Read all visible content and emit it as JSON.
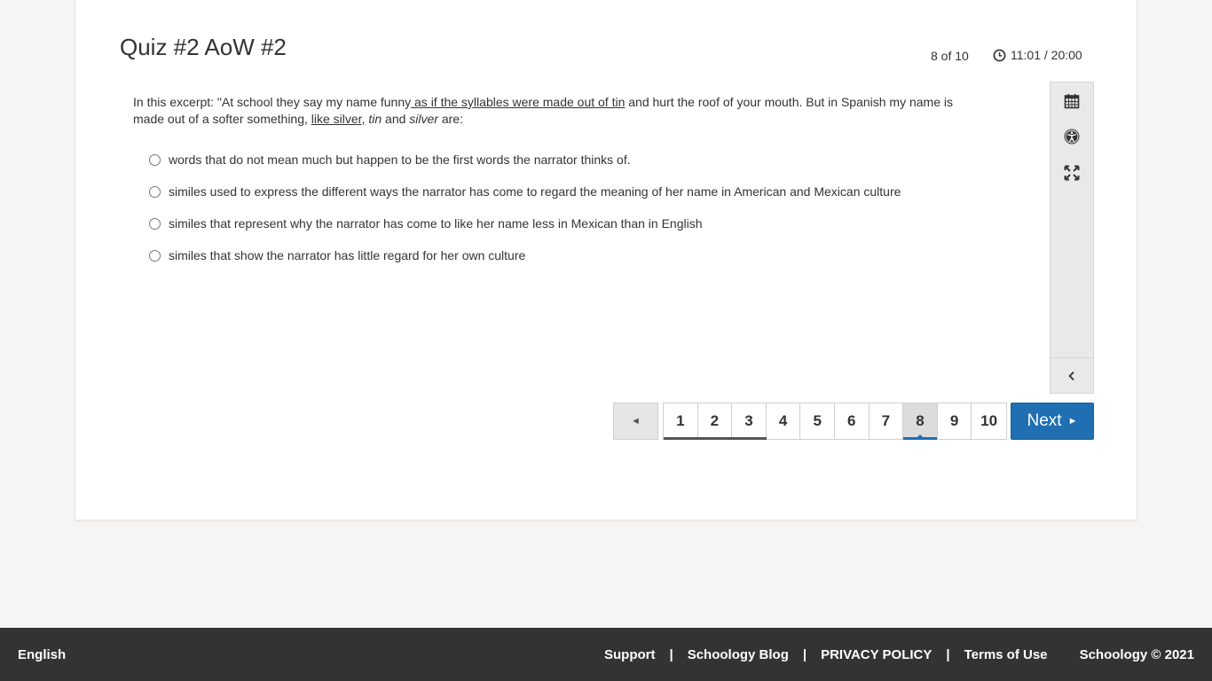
{
  "quiz": {
    "title": "Quiz #2 AoW #2",
    "progress": "8 of 10",
    "timer": "11:01 / 20:00"
  },
  "question": {
    "part1": "In this excerpt:  \"At school they say my name funny",
    "part2_underlined": " as if the syllables were made out of tin",
    "part3": " and hurt the roof of your mouth. But in Spanish my name is made out of a softer something, ",
    "part4_underlined": "like silver,",
    "part5": " ",
    "part6_italic": "tin",
    "part7": " and ",
    "part8_italic": "silver",
    "part9": " are:"
  },
  "answers": [
    "words  that do not mean much but happen to be the first words the narrator thinks of.",
    "similes used to express the different ways the narrator has come to regard  the meaning of  her name in American and Mexican culture",
    "similes that represent why the narrator has come to like her name less in Mexican  than in English",
    "similes that show the narrator has little regard for her own culture"
  ],
  "toolbar": {
    "icons": [
      "calendar-icon",
      "accessibility-icon",
      "fullscreen-icon",
      "chevron-left-icon"
    ]
  },
  "pager": {
    "prev_symbol": "◄",
    "pages": [
      "1",
      "2",
      "3",
      "4",
      "5",
      "6",
      "7",
      "8",
      "9",
      "10"
    ],
    "answered": [
      1,
      2,
      3
    ],
    "current": 8,
    "next_label": "Next",
    "next_symbol": "►",
    "accent_color": "#1f6fb2"
  },
  "footer": {
    "language": "English",
    "links": [
      "Support",
      "Schoology Blog",
      "PRIVACY POLICY",
      "Terms of Use"
    ],
    "separator": "|",
    "copyright": "Schoology © 2021"
  }
}
